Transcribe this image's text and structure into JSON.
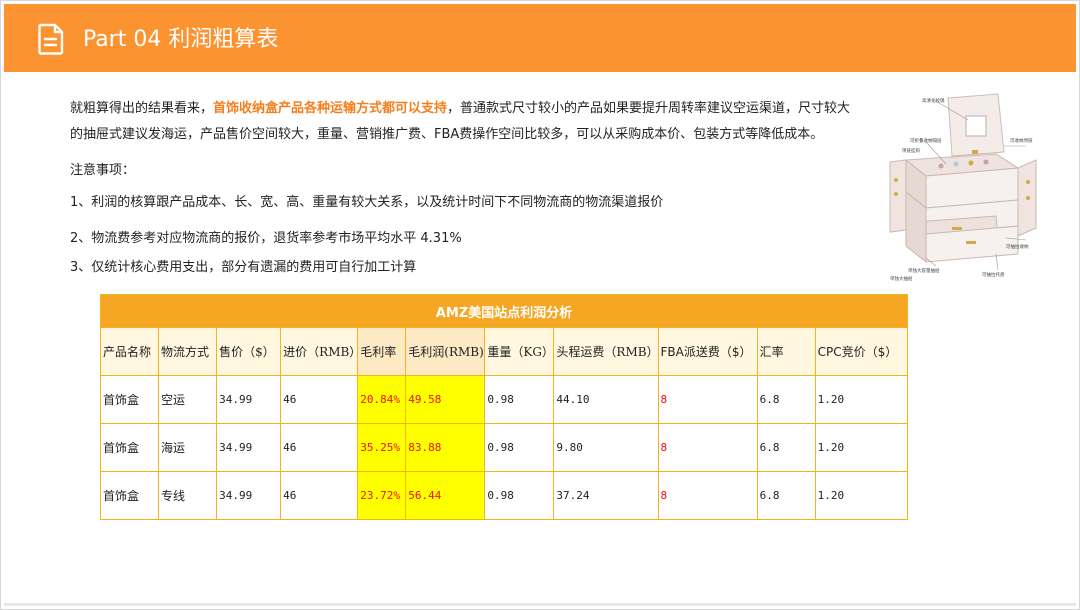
{
  "header": {
    "title": "Part 04 利润粗算表",
    "icon": "document-icon",
    "background": "#fb9330"
  },
  "intro": {
    "line1_before": "就粗算得出的结果看来，",
    "line1_highlight": "首饰收纳盒产品各种运输方式都可以支持",
    "line1_after": "，普通款式尺寸较小的产品如果要提升周转率建议空运渠道，尺寸较大",
    "line2": "的抽屉式建议发海运，产品售价空间较大，重量、营销推广费、FBA费操作空间比较多，可以从采购成本价、包装方式等降低成本。"
  },
  "notes": {
    "heading": "注意事项：",
    "items": [
      "1、利润的核算跟产品成本、长、宽、高、重量有较大关系，以及统计时间下不同物流商的物流渠道报价",
      "2、物流费参考对应物流商的报价，退货率参考市场平均水平 4.31%",
      "3、仅统计核心费用支出，部分有遗漏的费用可自行加工计算"
    ]
  },
  "product_image": {
    "name": "jewelry-box-illustration",
    "callouts": [
      "高清化妆镜",
      "可折叠收纳隔层",
      "项链挂钩",
      "可收纳项链",
      "单独大容量抽屉",
      "可抽拉收纳",
      "单独大抽屉",
      "可抽拉托盘"
    ]
  },
  "table": {
    "caption": "AMZ美国站点利润分析",
    "headers": [
      "产品名称",
      "物流方式",
      "售价（$）",
      "进价（RMB）",
      "毛利率",
      "毛利润(RMB)",
      "重量（KG）",
      "头程运费（RMB）",
      "FBA派送费（$）",
      "汇率",
      "CPC竞价（$）"
    ],
    "rows": [
      [
        "首饰盒",
        "空运",
        "34.99",
        "46",
        "20.84%",
        "49.58",
        "0.98",
        "44.10",
        "8",
        "6.8",
        "1.20"
      ],
      [
        "首饰盒",
        "海运",
        "34.99",
        "46",
        "35.25%",
        "83.88",
        "0.98",
        "9.80",
        "8",
        "6.8",
        "1.20"
      ],
      [
        "首饰盒",
        "专线",
        "34.99",
        "46",
        "23.72%",
        "56.44",
        "0.98",
        "37.24",
        "8",
        "6.8",
        "1.20"
      ]
    ],
    "colors": {
      "caption_bg": "#f5a623",
      "border": "#f5b21c",
      "highlight": "#ffff00",
      "red_text": "#ee1111"
    }
  }
}
